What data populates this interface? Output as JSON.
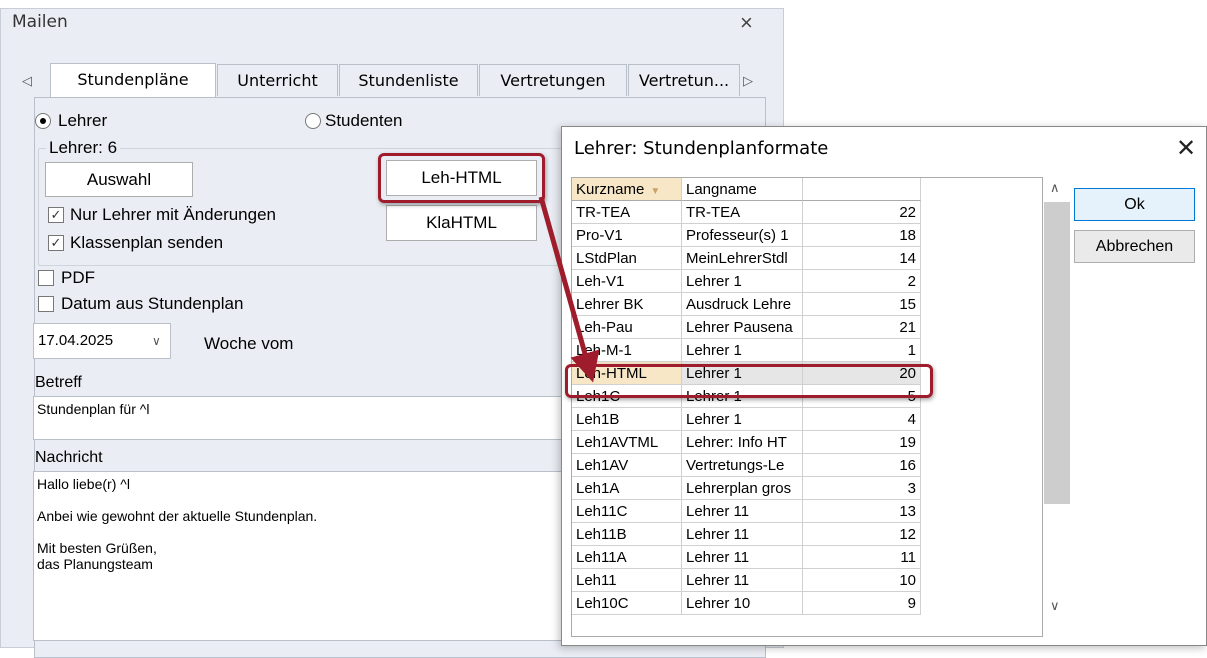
{
  "mailen": {
    "title": "Mailen",
    "close_glyph": "×",
    "tabs": [
      "Stundenpläne",
      "Unterricht",
      "Stundenliste",
      "Vertretungen",
      "Vertretun..."
    ],
    "active_tab": "Stundenpläne",
    "radio_lehrer": "Lehrer",
    "radio_studenten": "Studenten",
    "group_label": "Lehrer: 6",
    "auswahl_button": "Auswahl",
    "check_nur_lehrer": "Nur Lehrer mit Änderungen",
    "check_klassenplan": "Klassenplan senden",
    "format_button_1": "Leh-HTML",
    "format_button_2": "KlaHTML",
    "check_pdf": "PDF",
    "check_datum": "Datum aus Stundenplan",
    "date_value": "17.04.2025",
    "woche_label": "Woche vom",
    "betreff_label": "Betreff",
    "betreff_value": "Stundenplan für ^l",
    "nachricht_label": "Nachricht",
    "nachricht_lines": [
      "Hallo liebe(r) ^l",
      "",
      "Anbei wie gewohnt der aktuelle Stundenplan.",
      "",
      "Mit besten Grüßen,",
      "das Planungsteam"
    ]
  },
  "dialog": {
    "title": "Lehrer: Stundenplanformate",
    "close_glyph": "✕",
    "ok_label": "Ok",
    "cancel_label": "Abbrechen",
    "columns": [
      "Kurzname",
      "Langname",
      ""
    ],
    "rows": [
      [
        "TR-TEA",
        "TR-TEA",
        "22"
      ],
      [
        "Pro-V1",
        "Professeur(s) 1",
        "18"
      ],
      [
        "LStdPlan",
        "MeinLehrerStdl",
        "14"
      ],
      [
        "Leh-V1",
        "Lehrer 1",
        "2"
      ],
      [
        "Lehrer  BK",
        "Ausdruck Lehre",
        "15"
      ],
      [
        "Leh-Pau",
        "Lehrer Pausena",
        "21"
      ],
      [
        "Leh-M-1",
        "Lehrer 1",
        "1"
      ],
      [
        "Leh-HTML",
        "Lehrer 1",
        "20"
      ],
      [
        "Leh1C",
        "Lehrer 1",
        "5"
      ],
      [
        "Leh1B",
        "Lehrer 1",
        "4"
      ],
      [
        "Leh1AVTML",
        "Lehrer: Info HT",
        "19"
      ],
      [
        "Leh1AV",
        "Vertretungs-Le",
        "16"
      ],
      [
        "Leh1A",
        "Lehrerplan gros",
        "3"
      ],
      [
        "Leh11C",
        "Lehrer 11",
        "13"
      ],
      [
        "Leh11B",
        "Lehrer 11",
        "12"
      ],
      [
        "Leh11A",
        "Lehrer 11",
        "11"
      ],
      [
        "Leh11",
        "Lehrer 11",
        "10"
      ],
      [
        "Leh10C",
        "Lehrer 10",
        "9"
      ]
    ],
    "selected_row": "Leh-HTML"
  },
  "colors": {
    "highlight": "#9e1c2c",
    "selection": "#f7e7c7"
  }
}
